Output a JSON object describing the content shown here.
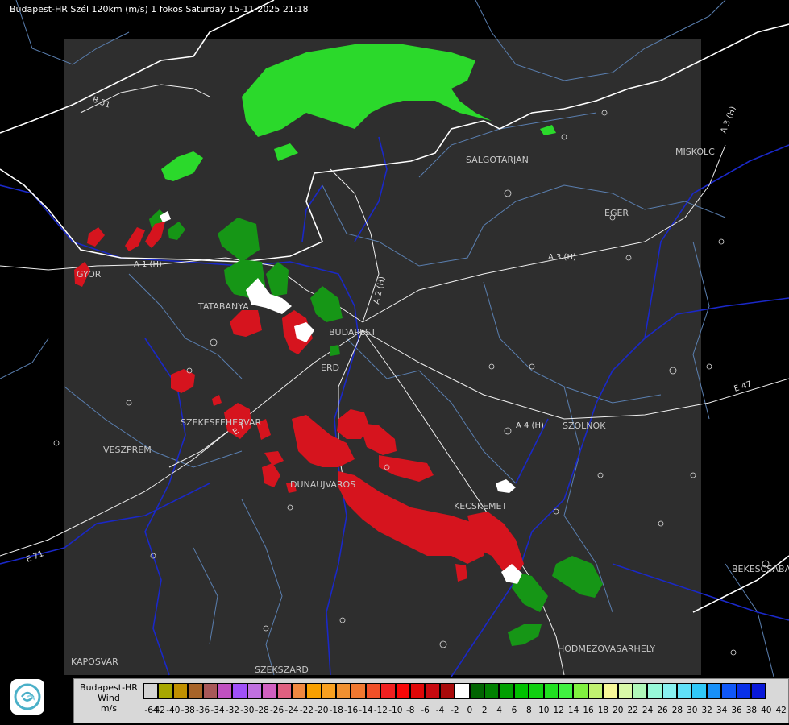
{
  "title": "Budapest-HR Szél 120km (m/s) 1 fokos Saturday 15-11-2025 21:18",
  "map": {
    "cities": [
      "SALGOTARJAN",
      "MISKOLC",
      "EGER",
      "TATABANYA",
      "BUDAPEST",
      "ERD",
      "SZEKESFEHERVAR",
      "VESZPREM",
      "DUNAUJVAROS",
      "KECSKEMET",
      "SZOLNOK",
      "HODMEZOVASARHELY",
      "BEKESCSABA",
      "KAPOSVAR",
      "SZEKSZARD",
      "GYOR"
    ],
    "roads": [
      "B 51",
      "A 1 (H)",
      "A 2 (H)",
      "A 3 (H)",
      "A 3 (H)",
      "A 4 (H)",
      "E 47",
      "E 71",
      "E 7"
    ],
    "colors": {
      "map_background": "#000000",
      "radar_area": "#2e2e2e",
      "border_line": "#ffffff",
      "river": "#1a28c8",
      "county_line": "#5a7fb0",
      "road": "#f0f0f0",
      "approaching": "#d6141e",
      "receding": "#2bd92b"
    }
  },
  "legend": {
    "title_lines": [
      "Budapest-HR",
      "Wind",
      "m/s"
    ],
    "colors": [
      "#d4d4d4",
      "#a8a800",
      "#c09000",
      "#a86428",
      "#a85858",
      "#c050c0",
      "#a050f8",
      "#c070e0",
      "#d060c0",
      "#e06080",
      "#f08840",
      "#f8a000",
      "#f8a020",
      "#f09030",
      "#f07830",
      "#f05028",
      "#f02020",
      "#f80808",
      "#e00808",
      "#c80a10",
      "#a80a0a",
      "#ffffff",
      "#006400",
      "#008000",
      "#00a000",
      "#00c000",
      "#10d010",
      "#20e020",
      "#40f040",
      "#80f040",
      "#c0f070",
      "#f8f898",
      "#d8f8a8",
      "#b0f8b8",
      "#98f8d8",
      "#88f0f0",
      "#60e0f8",
      "#30c8f8",
      "#1890f8",
      "#1058f8",
      "#0830e8",
      "#0818d8"
    ],
    "ticks": [
      "-64",
      "-42",
      "-40",
      "-38",
      "-36",
      "-34",
      "-32",
      "-30",
      "-28",
      "-26",
      "-24",
      "-22",
      "-20",
      "-18",
      "-16",
      "-14",
      "-12",
      "-10",
      "-8",
      "-6",
      "-4",
      "-2",
      "0",
      "2",
      "4",
      "6",
      "8",
      "10",
      "12",
      "14",
      "16",
      "18",
      "20",
      "22",
      "24",
      "26",
      "28",
      "30",
      "32",
      "34",
      "36",
      "38",
      "40",
      "42"
    ]
  },
  "logo_icon": "omsz-logo"
}
